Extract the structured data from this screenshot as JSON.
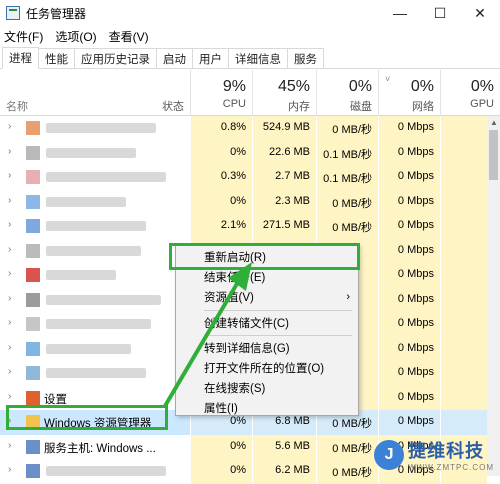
{
  "window": {
    "title": "任务管理器",
    "minimize": "—",
    "maximize": "☐",
    "close": "✕"
  },
  "menu": [
    "文件(F)",
    "选项(O)",
    "查看(V)"
  ],
  "tabs": [
    "进程",
    "性能",
    "应用历史记录",
    "启动",
    "用户",
    "详细信息",
    "服务"
  ],
  "header": {
    "name": "名称",
    "status": "状态",
    "cpu": {
      "pct": "9%",
      "label": "CPU"
    },
    "memory": {
      "pct": "45%",
      "label": "内存"
    },
    "disk": {
      "pct": "0%",
      "label": "磁盘"
    },
    "network": {
      "pct": "0%",
      "label": "网络"
    },
    "gpu": {
      "pct": "0%",
      "label": "GPU"
    }
  },
  "rows": [
    {
      "name": "",
      "cpu": "0.8%",
      "memory": "524.9 MB",
      "disk": "0 MB/秒",
      "network": "0 Mbps",
      "icon_color": "#e9a070"
    },
    {
      "name": "",
      "cpu": "0%",
      "memory": "22.6 MB",
      "disk": "0.1 MB/秒",
      "network": "0 Mbps",
      "icon_color": "#b9b9b9"
    },
    {
      "name": "",
      "cpu": "0.3%",
      "memory": "2.7 MB",
      "disk": "0.1 MB/秒",
      "network": "0 Mbps",
      "icon_color": "#e8b0b0"
    },
    {
      "name": "",
      "cpu": "0%",
      "memory": "2.3 MB",
      "disk": "0 MB/秒",
      "network": "0 Mbps",
      "icon_color": "#8db7e6"
    },
    {
      "name": "",
      "cpu": "2.1%",
      "memory": "271.5 MB",
      "disk": "0 MB/秒",
      "network": "0 Mbps",
      "icon_color": "#7fa8df"
    },
    {
      "name": "",
      "cpu": "",
      "memory": "",
      "disk": "",
      "network": "0 Mbps",
      "icon_color": "#bbbbbb"
    },
    {
      "name": "",
      "cpu": "",
      "memory": "",
      "disk": "",
      "network": "0 Mbps",
      "icon_color": "#d9534f"
    },
    {
      "name": "",
      "cpu": "",
      "memory": "",
      "disk": "",
      "network": "0 Mbps",
      "icon_color": "#9c9c9c"
    },
    {
      "name": "",
      "cpu": "",
      "memory": "",
      "disk": "",
      "network": "0 Mbps",
      "icon_color": "#c6c6c6"
    },
    {
      "name": "",
      "cpu": "",
      "memory": "",
      "disk": "",
      "network": "0 Mbps",
      "icon_color": "#7fb5e0"
    },
    {
      "name": "",
      "cpu": "",
      "memory": "",
      "disk": "",
      "network": "0 Mbps",
      "icon_color": "#8fb8d8"
    },
    {
      "name": "设置",
      "cpu": "",
      "memory": "",
      "disk": "",
      "network": "0 Mbps",
      "icon_color": "#e06030"
    },
    {
      "name": "Windows 资源管理器",
      "cpu": "0%",
      "memory": "6.8 MB",
      "disk": "0 MB/秒",
      "network": "0 Mbps",
      "icon_color": "#f2c14e"
    },
    {
      "name": "服务主机: Windows ...",
      "cpu": "0%",
      "memory": "5.6 MB",
      "disk": "0 MB/秒",
      "network": "0 Mbps",
      "icon_color": "#6a8fc9"
    },
    {
      "name": "",
      "cpu": "0%",
      "memory": "6.2 MB",
      "disk": "0 MB/秒",
      "network": "0 Mbps",
      "icon_color": "#6a8fc9"
    }
  ],
  "context_menu": {
    "items": [
      {
        "label": "重新启动(R)"
      },
      {
        "label": "结束任务(E)"
      },
      {
        "label": "资源值(V)",
        "submenu": "›"
      },
      {
        "label": "创建转储文件(C)"
      },
      {
        "label": "转到详细信息(G)"
      },
      {
        "label": "打开文件所在的位置(O)"
      },
      {
        "label": "在线搜索(S)"
      },
      {
        "label": "属性(I)"
      }
    ]
  },
  "watermark": {
    "logo": "J",
    "text": "捷维科技",
    "url": "WWW.ZMTPC.COM"
  },
  "colors": {
    "highlight": "#2fae3a",
    "cell_bg": "#fff4c4",
    "selected": "#cce8ff"
  }
}
